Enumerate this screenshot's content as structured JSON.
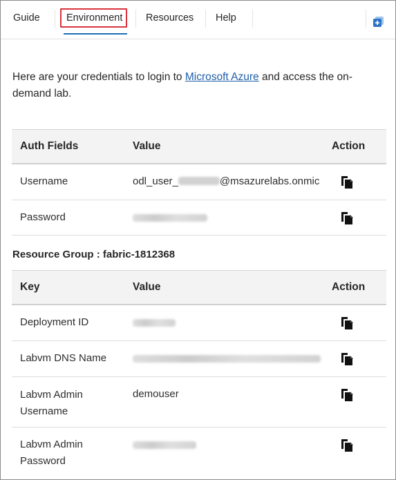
{
  "tabs": [
    {
      "label": "Guide"
    },
    {
      "label": "Environment",
      "active": true
    },
    {
      "label": "Resources"
    },
    {
      "label": "Help"
    }
  ],
  "corner_icon": "expand-window-icon",
  "intro": {
    "before": "Here are your credentials to login to ",
    "link": "Microsoft Azure",
    "after": " and access the on-demand lab."
  },
  "auth_table": {
    "headers": {
      "field": "Auth Fields",
      "value": "Value",
      "action": "Action"
    },
    "rows": [
      {
        "field": "Username",
        "value_prefix": "odl_user_",
        "value_suffix": "@msazurelabs.onmic",
        "value_redacted": true
      },
      {
        "field": "Password",
        "value_redacted": true
      }
    ]
  },
  "resource_group": {
    "title": "Resource Group : fabric-1812368",
    "headers": {
      "field": "Key",
      "value": "Value",
      "action": "Action"
    },
    "rows": [
      {
        "field": "Deployment ID",
        "value_redacted": true
      },
      {
        "field": "Labvm DNS Name",
        "value_redacted": true
      },
      {
        "field_line1": "Labvm Admin",
        "field_line2": "Username",
        "value": "demouser"
      },
      {
        "field_line1": "Labvm Admin",
        "field_line2": "Password",
        "value_redacted": true
      }
    ]
  },
  "icons": {
    "copy": "copy-icon"
  },
  "colors": {
    "active_tab_border": "#d9323c",
    "active_tab_underline": "#1f6fb5",
    "link": "#1f5ea8",
    "header_bg": "#f3f3f3"
  }
}
